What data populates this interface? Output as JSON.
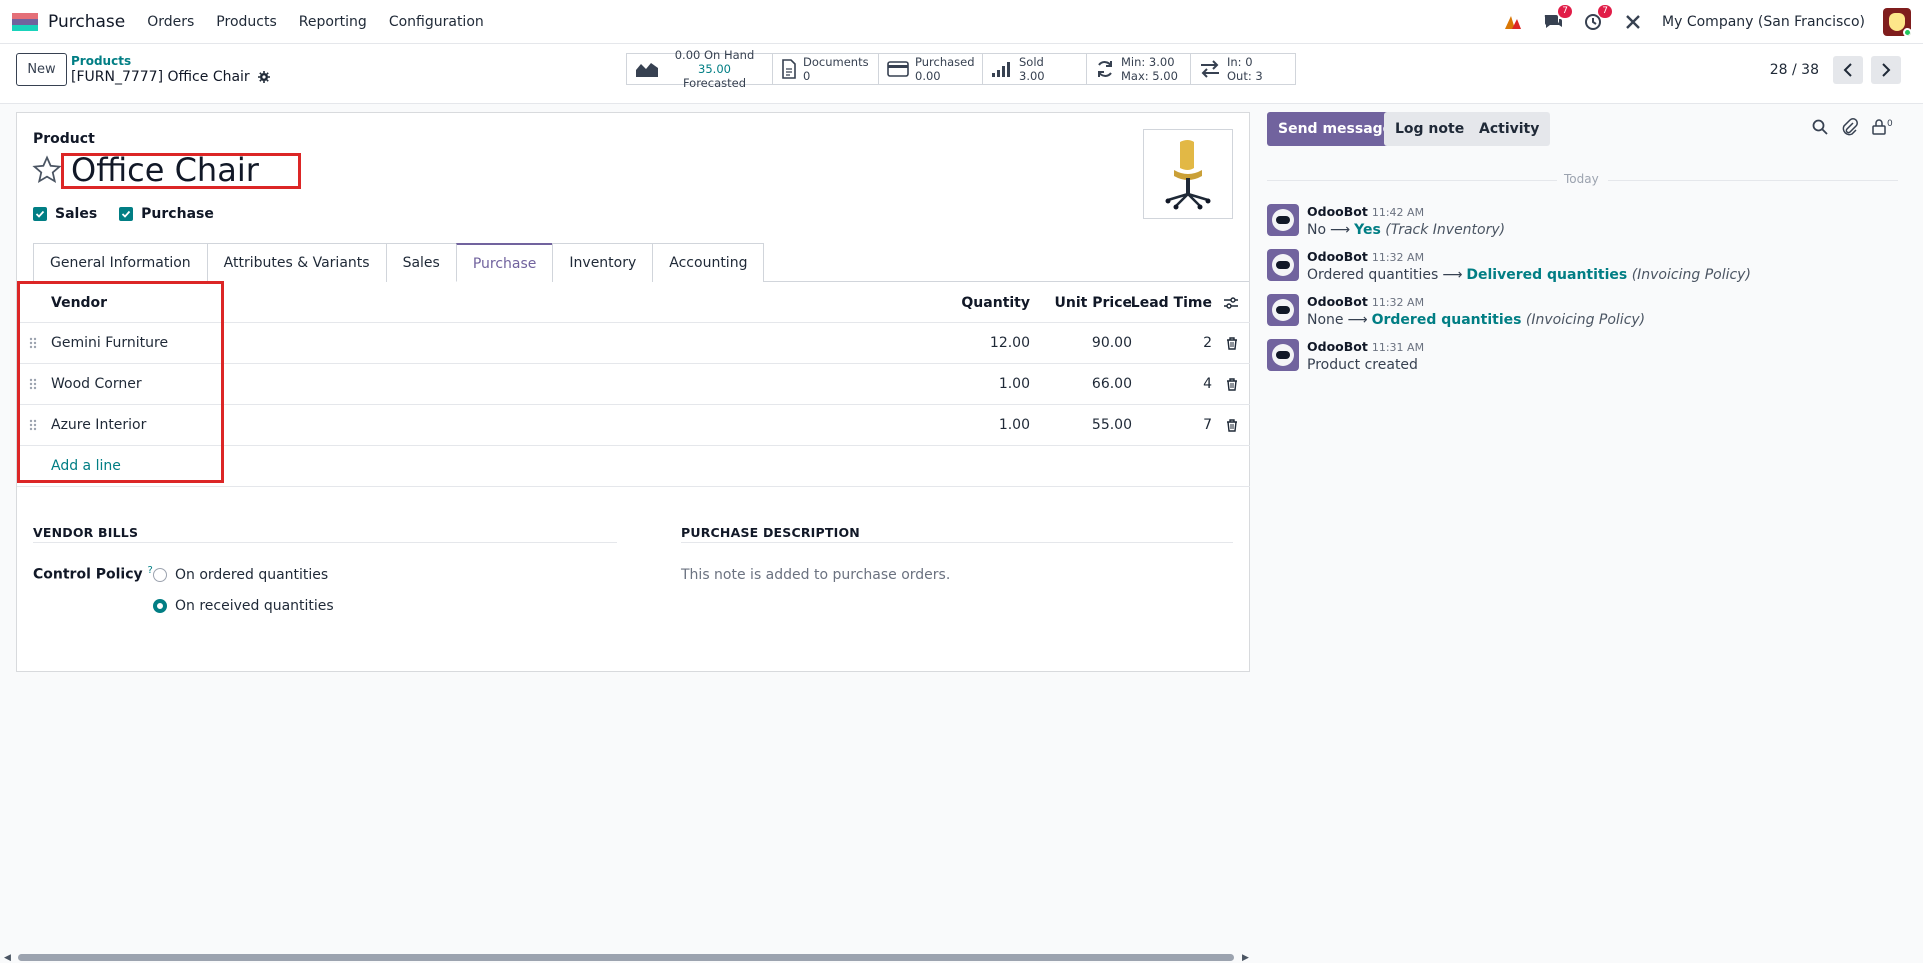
{
  "navbar": {
    "app_name": "Purchase",
    "menu": [
      "Orders",
      "Products",
      "Reporting",
      "Configuration"
    ],
    "messages_badge": "7",
    "activities_badge": "7",
    "company": "My Company (San Francisco)"
  },
  "control_panel": {
    "new_label": "New",
    "breadcrumb_root": "Products",
    "breadcrumb_current": "[FURN_7777] Office Chair",
    "stats": {
      "on_hand_value": "0.00",
      "on_hand_label": "On Hand",
      "forecast_value": "35.00",
      "forecast_label": "Forecasted",
      "documents_label": "Documents",
      "documents_value": "0",
      "purchased_label": "Purchased",
      "purchased_value": "0.00",
      "sold_label": "Sold",
      "sold_value": "3.00",
      "min_text": "Min: 3.00",
      "max_text": "Max: 5.00",
      "in_text": "In: 0",
      "out_text": "Out: 3"
    },
    "pager": "28 / 38"
  },
  "form": {
    "product_label": "Product",
    "product_name": "Office Chair",
    "sales_label": "Sales",
    "purchase_label": "Purchase",
    "tabs": [
      "General Information",
      "Attributes & Variants",
      "Sales",
      "Purchase",
      "Inventory",
      "Accounting"
    ],
    "active_tab": "Purchase",
    "vendor_table": {
      "headers": {
        "vendor": "Vendor",
        "quantity": "Quantity",
        "unit_price": "Unit Price",
        "lead_time": "Lead Time"
      },
      "rows": [
        {
          "vendor": "Gemini Furniture",
          "quantity": "12.00",
          "unit_price": "90.00",
          "lead_time": "2"
        },
        {
          "vendor": "Wood Corner",
          "quantity": "1.00",
          "unit_price": "66.00",
          "lead_time": "4"
        },
        {
          "vendor": "Azure Interior",
          "quantity": "1.00",
          "unit_price": "55.00",
          "lead_time": "7"
        }
      ],
      "add_line": "Add a line"
    },
    "vendor_bills_title": "VENDOR BILLS",
    "control_policy_label": "Control Policy",
    "control_policy_help": "?",
    "control_policy_options": [
      "On ordered quantities",
      "On received quantities"
    ],
    "control_policy_selected": "On received quantities",
    "purchase_description_title": "PURCHASE DESCRIPTION",
    "purchase_description_placeholder": "This note is added to purchase orders."
  },
  "chatter": {
    "send_message": "Send message",
    "log_note": "Log note",
    "activity": "Activity",
    "followers_count": "0",
    "today": "Today",
    "messages": [
      {
        "author": "OdooBot",
        "time": "11:42 AM",
        "old": "No",
        "new": "Yes",
        "field": "(Track Inventory)"
      },
      {
        "author": "OdooBot",
        "time": "11:32 AM",
        "old": "Ordered quantities",
        "new": "Delivered quantities",
        "field": "(Invoicing Policy)"
      },
      {
        "author": "OdooBot",
        "time": "11:32 AM",
        "old": "None",
        "new": "Ordered quantities",
        "field": "(Invoicing Policy)"
      },
      {
        "author": "OdooBot",
        "time": "11:31 AM",
        "text": "Product created"
      }
    ]
  },
  "colors": {
    "brand": "#71639e",
    "accent": "#017e84",
    "highlight": "#dc2626"
  }
}
